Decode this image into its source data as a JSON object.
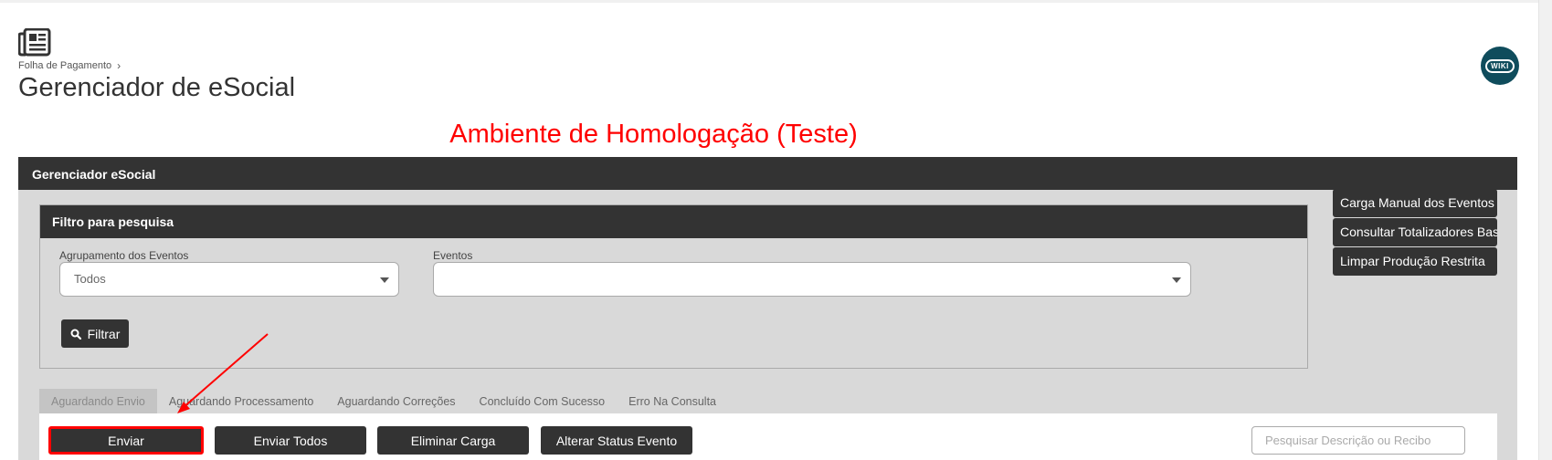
{
  "header": {
    "breadcrumb": "Folha de Pagamento",
    "breadcrumb_chevron": "›",
    "title": "Gerenciador de eSocial",
    "page_icon": "newspaper-icon",
    "wiki_label": "WIKI"
  },
  "environment_banner": "Ambiente de Homologação (Teste)",
  "panel": {
    "title": "Gerenciador eSocial",
    "filter": {
      "title": "Filtro para pesquisa",
      "grouping_label": "Agrupamento dos Eventos",
      "grouping_value": "Todos",
      "events_label": "Eventos",
      "events_value": "",
      "filter_button": "Filtrar"
    },
    "side_buttons": [
      "Carga Manual dos Eventos",
      "Consultar Totalizadores Base",
      "Limpar Produção Restrita"
    ],
    "tabs": [
      "Aguardando Envio",
      "Aguardando Processamento",
      "Aguardando Correções",
      "Concluído Com Sucesso",
      "Erro Na Consulta"
    ],
    "active_tab": "Aguardando Envio",
    "actions": [
      "Enviar",
      "Enviar Todos",
      "Eliminar Carga",
      "Alterar Status Evento"
    ],
    "search_placeholder": "Pesquisar Descrição ou Recibo"
  },
  "colors": {
    "dark": "#333333",
    "panel_bg": "#d9d9d9",
    "annotation_red": "#ff0000",
    "wiki_teal": "#0f4c5c"
  }
}
